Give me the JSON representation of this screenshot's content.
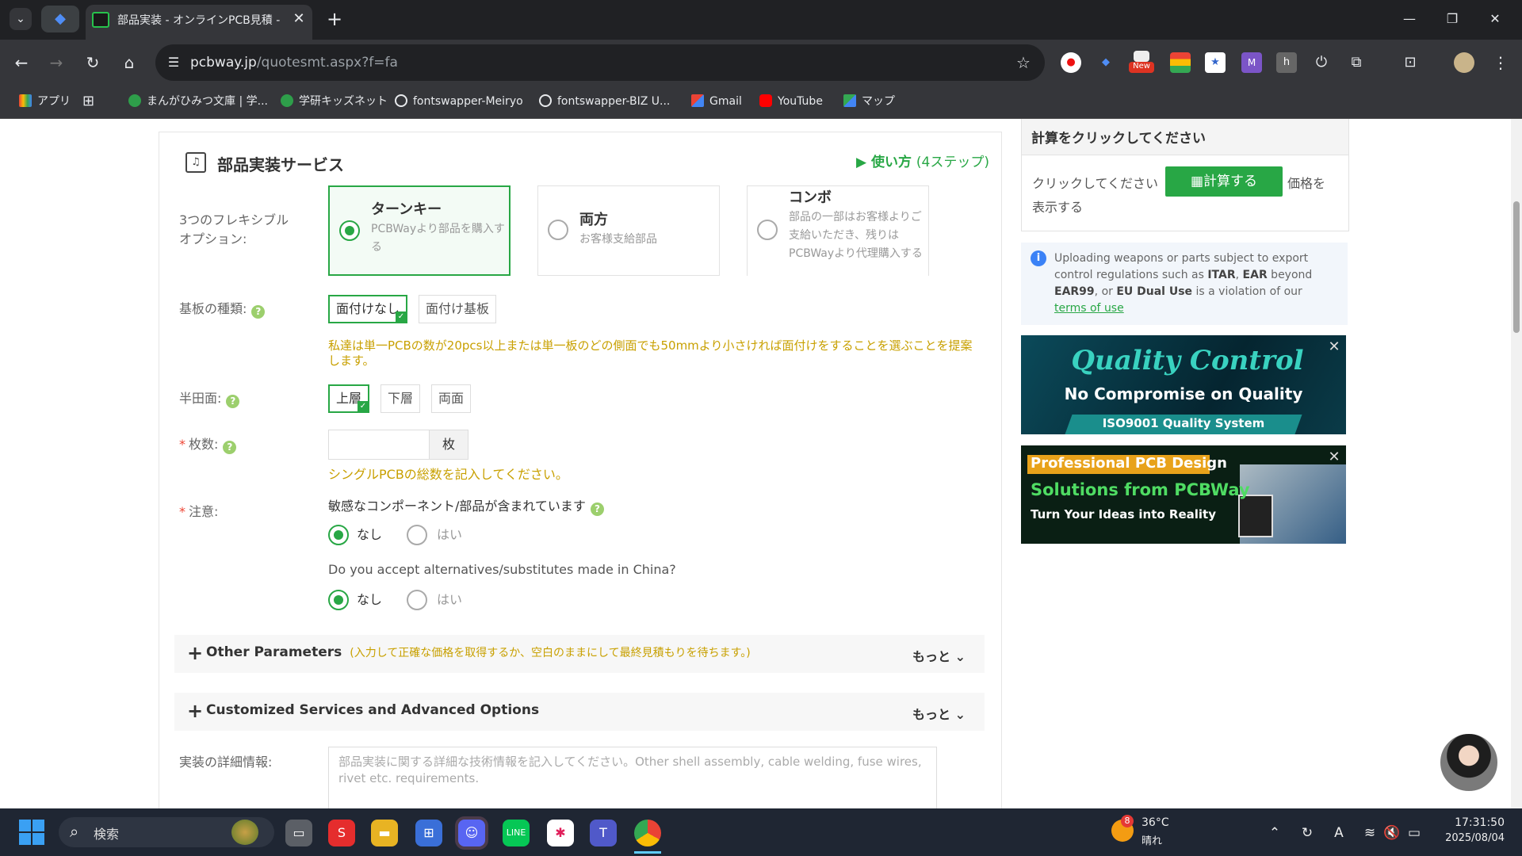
{
  "browser": {
    "tab_title": "部品実装 - オンラインPCB見積 - 低",
    "url_domain": "pcbway.jp",
    "url_path": "/quotesmt.aspx?f=fa",
    "ext_new_badge": "New",
    "bookmarks": [
      "アプリ",
      "まんがひみつ文庫 | 学...",
      "学研キッズネット",
      "fontswapper-Meiryo",
      "fontswapper-BIZ U...",
      "Gmail",
      "YouTube",
      "マップ"
    ]
  },
  "form": {
    "section_title": "部品実装サービス",
    "howto_label": "▶ 使い方",
    "howto_steps": "(4ステップ)",
    "options_label_1": "3つのフレキシブル",
    "options_label_2": "オプション:",
    "options": [
      {
        "title": "ターンキー",
        "desc": "PCBWayより部品を購入する"
      },
      {
        "title": "両方",
        "desc": "お客様支給部品"
      },
      {
        "title": "コンボ",
        "desc": "部品の一部はお客様よりご支給いただき、残りはPCBWayより代理購入する"
      }
    ],
    "board_type_label": "基板の種類:",
    "board_type_options": [
      "面付けなし",
      "面付け基板"
    ],
    "panel_note": "私達は単一PCBの数が20pcs以上または単一板のどの側面でも50mmより小さければ面付けをすることを選ぶことを提案します。",
    "solder_side_label": "半田面:",
    "solder_side_options": [
      "上層",
      "下層",
      "両面"
    ],
    "qty_label": "枚数:",
    "qty_unit": "枚",
    "qty_note": "シングルPCBの総数を記入してください。",
    "notes_label": "注意:",
    "sensitive_question": "敏感なコンポーネント/部品が含まれています",
    "alternatives_question": "Do you accept alternatives/substitutes made in China?",
    "radio_no": "なし",
    "radio_yes": "はい",
    "other_params_title": "Other Parameters",
    "other_params_hint": "(入力して正確な価格を取得するか、空白のままにして最終見積もりを待ちます。)",
    "more_label": "もっと",
    "custom_services_title": "Customized Services and Advanced Options",
    "detail_label": "実装の詳細情報:",
    "detail_placeholder": "部品実装に関する詳細な技術情報を記入してください。Other shell assembly, cable welding, fuse wires, rivet etc. requirements."
  },
  "sidebar": {
    "calc_title": "計算をクリックしてください",
    "calc_prefix": "クリックしてください",
    "calc_button": "計算する",
    "calc_suffix": "価格を",
    "calc_suffix2": "表示する",
    "notice_1": "Uploading weapons or parts subject to export control regulations such as ",
    "notice_itar": "ITAR",
    "notice_comma": ", ",
    "notice_ear": "EAR",
    "notice_2": " beyond ",
    "notice_ear99": "EAR99",
    "notice_3": ", or ",
    "notice_eu": "EU Dual Use",
    "notice_4": " is a violation of our ",
    "notice_link": "terms of use",
    "ad1_title": "Quality Control",
    "ad1_sub": "No Compromise on Quality",
    "ad1_band": "ISO9001 Quality System",
    "ad2_line1": "Professional PCB Design",
    "ad2_line2": "Solutions from PCBWay",
    "ad2_line3": "Turn Your Ideas into Reality"
  },
  "taskbar": {
    "search_label": "検索",
    "weather_temp": "36°C",
    "weather_text": "晴れ",
    "weather_badge": "8",
    "time": "17:31:50",
    "date": "2025/08/04"
  },
  "colors": {
    "accent": "#28a745",
    "note": "#c8a000",
    "tab_bg": "#202124",
    "toolbar_bg": "#35363a"
  }
}
